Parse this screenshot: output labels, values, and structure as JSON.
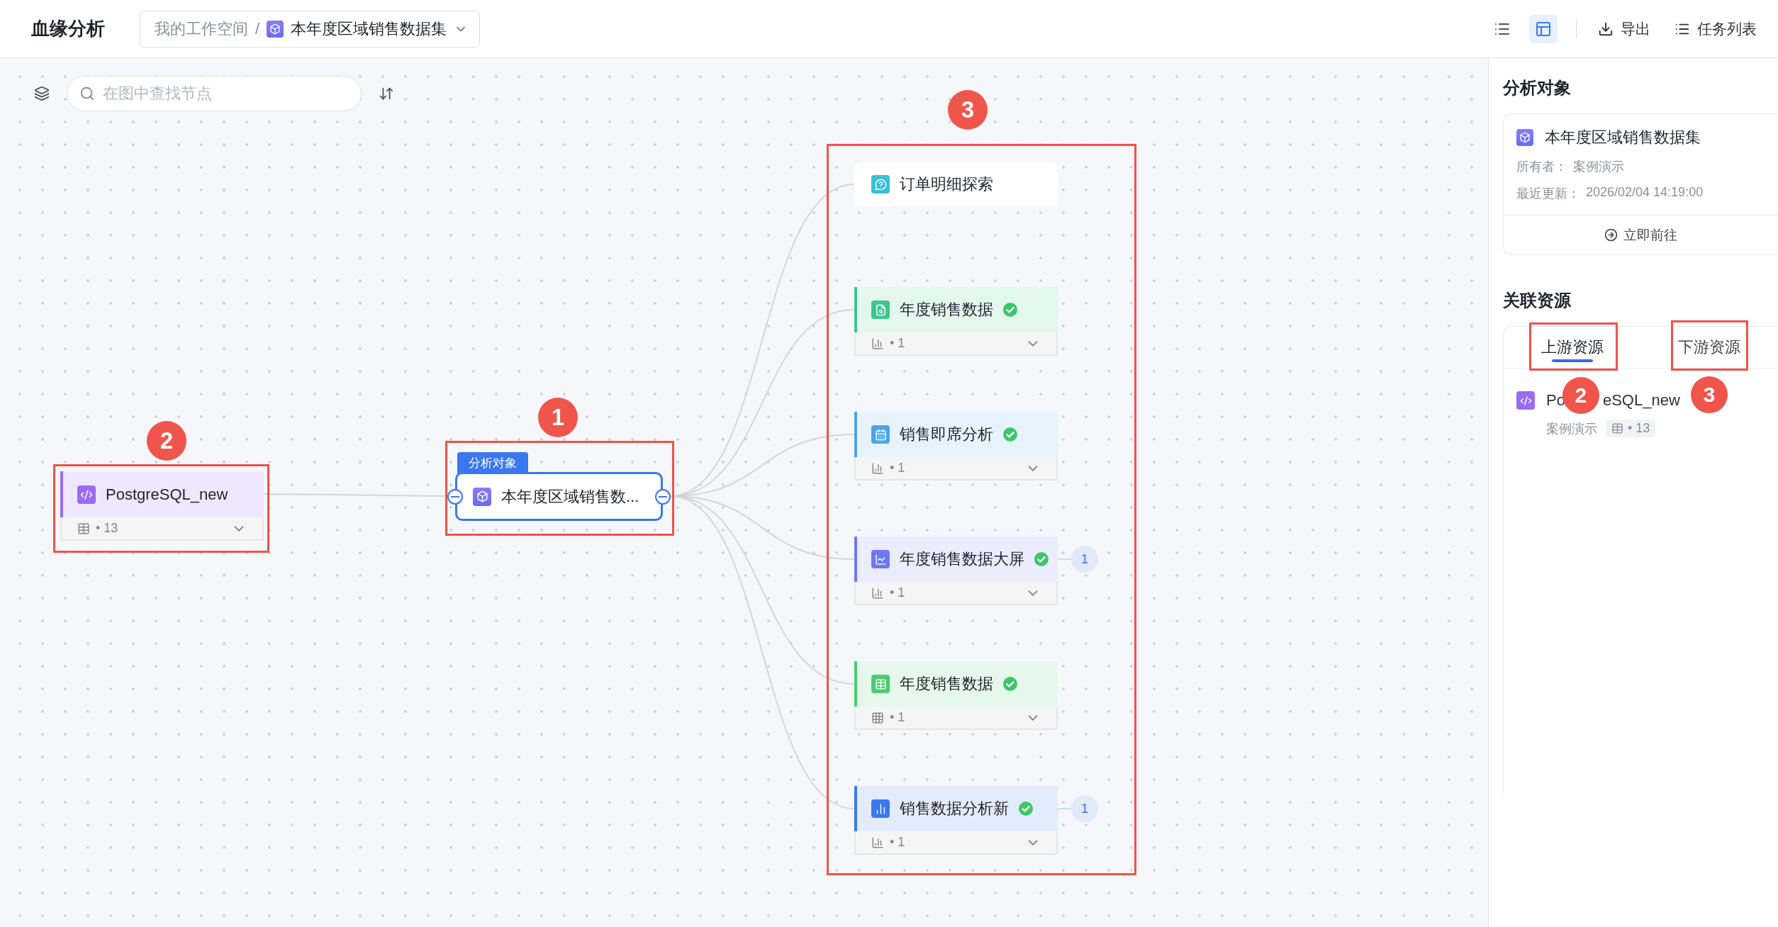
{
  "header": {
    "title": "血缘分析",
    "breadcrumb": {
      "workspace": "我的工作空间",
      "separator": "/",
      "current": "本年度区域销售数据集"
    },
    "actions": [
      {
        "kind": "list-view",
        "selected": false
      },
      {
        "kind": "panel-view",
        "selected": true
      },
      {
        "kind": "export",
        "label": "导出"
      },
      {
        "kind": "tasks",
        "label": "任务列表"
      }
    ]
  },
  "canvas": {
    "search": {
      "placeholder": "在图中查找节点"
    },
    "upstream": {
      "name": "PostgreSQL_new",
      "count": "• 13"
    },
    "analysis_object": {
      "tag": "分析对象",
      "name": "本年度区域销售数..."
    },
    "downstream": [
      {
        "kind": "exploration",
        "name": "订单明细探索",
        "color": "#3cbfd4"
      },
      {
        "kind": "report",
        "name": "年度销售数据",
        "color": "#3cc68f",
        "verified": true,
        "count": "• 1"
      },
      {
        "kind": "adhoc",
        "name": "销售即席分析",
        "color": "#4aa7e8",
        "verified": true,
        "count": "• 1"
      },
      {
        "kind": "dashboard",
        "name": "年度销售数据大屏",
        "color": "#6f78f2",
        "verified": true,
        "count": "• 1",
        "linked": "1"
      },
      {
        "kind": "sheet",
        "name": "年度销售数据",
        "color": "#4ccd6f",
        "verified": true,
        "count": "• 1"
      },
      {
        "kind": "chart",
        "name": "销售数据分析新",
        "color": "#3a78f0",
        "verified": true,
        "count": "• 1",
        "linked": "1"
      }
    ],
    "annotations": [
      {
        "label": "2"
      },
      {
        "label": "1"
      },
      {
        "label": "3"
      }
    ]
  },
  "panel": {
    "analysis_object": {
      "heading": "分析对象",
      "name": "本年度区域销售数据集",
      "owner_label": "所有者：",
      "owner": "案例演示",
      "updated_label": "最近更新：",
      "updated": "2026/02/04 14:19:00",
      "action": "立即前往"
    },
    "related": {
      "heading": "关联资源",
      "tabs": [
        {
          "label": "上游资源",
          "selected": true
        },
        {
          "label": "下游资源",
          "selected": false
        }
      ],
      "items": [
        {
          "name_parts": [
            "Po",
            "eSQL_new"
          ],
          "owner": "案例演示",
          "count": "• 13"
        }
      ],
      "annotations": [
        {
          "label": "2"
        },
        {
          "label": "3"
        }
      ]
    }
  }
}
